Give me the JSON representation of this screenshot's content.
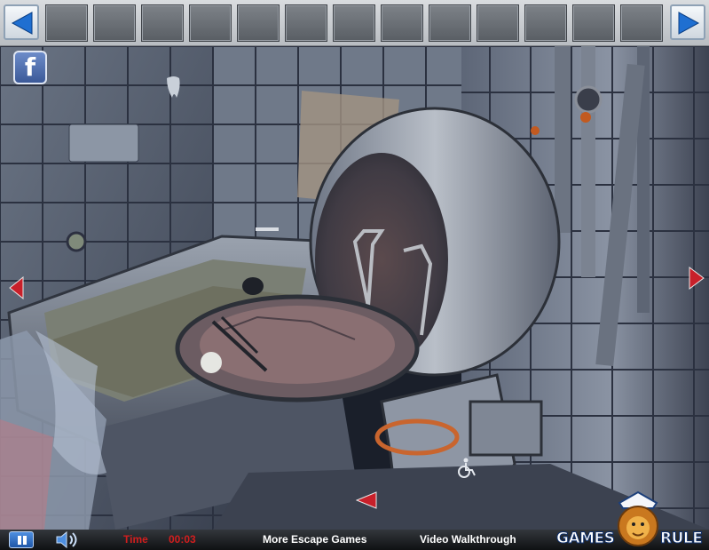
{
  "inventory": {
    "slot_count": 13
  },
  "bottom_bar": {
    "time_label": "Time",
    "time_value": "00:03",
    "more_games": "More Escape Games",
    "walkthrough": "Video Walkthrough"
  },
  "brand": {
    "left": "GAMES",
    "right": "RULE"
  },
  "social": {
    "facebook_glyph": "f"
  },
  "colors": {
    "nav_arrow": "#c8202a",
    "time_text": "#d21e1e",
    "inventory_arrow": "#1f6fd1",
    "facebook": "#3b5998"
  },
  "icons": [
    "inventory-prev-icon",
    "inventory-next-icon",
    "facebook-icon",
    "nav-left-icon",
    "nav-right-icon",
    "nav-down-icon",
    "pause-icon",
    "sound-icon",
    "wheelchair-icon",
    "lion-mascot-icon"
  ]
}
